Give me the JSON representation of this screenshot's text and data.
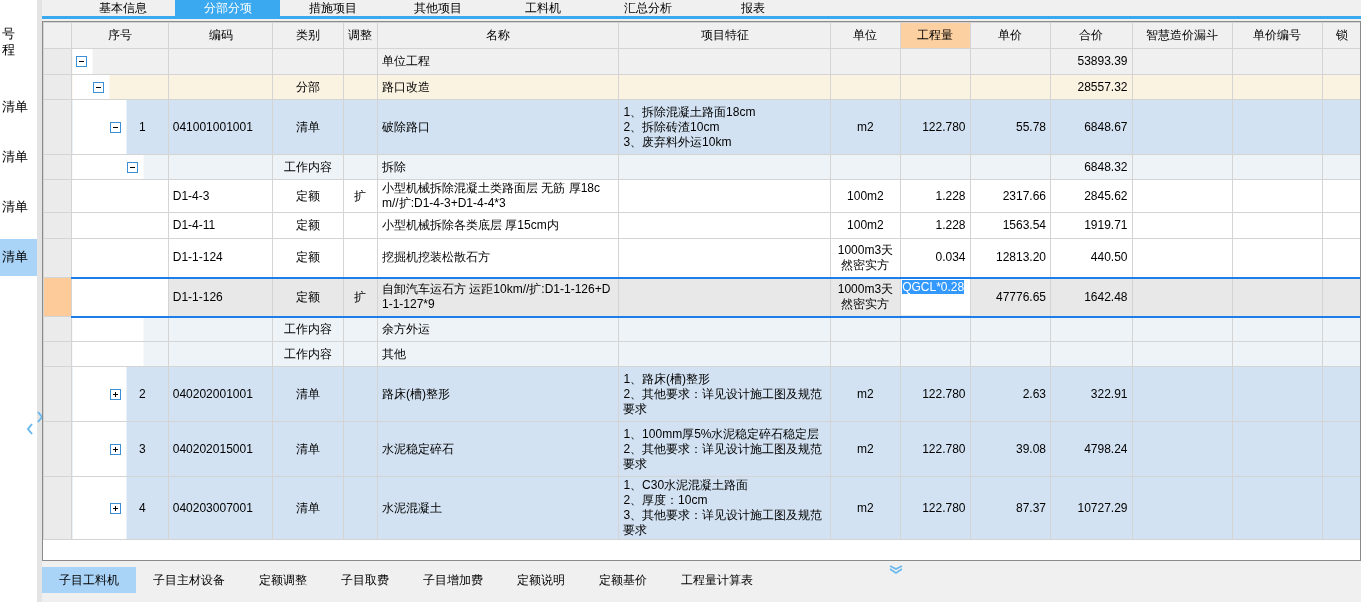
{
  "top_tabs": [
    {
      "label": "基本信息",
      "selected": false
    },
    {
      "label": "分部分项",
      "selected": true
    },
    {
      "label": "措施项目",
      "selected": false
    },
    {
      "label": "其他项目",
      "selected": false
    },
    {
      "label": "工料机",
      "selected": false
    },
    {
      "label": "汇总分析",
      "selected": false
    },
    {
      "label": "报表",
      "selected": false
    }
  ],
  "sidebar": {
    "items": [
      {
        "label": "号",
        "selected": false
      },
      {
        "label": "程",
        "selected": false
      },
      {
        "label": "清单",
        "selected": false
      },
      {
        "label": "清单",
        "selected": false
      },
      {
        "label": "清单",
        "selected": false
      },
      {
        "label": "清单",
        "selected": true
      }
    ]
  },
  "table": {
    "columns": [
      {
        "label": "序号",
        "selected": false
      },
      {
        "label": "编码",
        "selected": false
      },
      {
        "label": "类别",
        "selected": false
      },
      {
        "label": "调整",
        "selected": false
      },
      {
        "label": "名称",
        "selected": false
      },
      {
        "label": "项目特征",
        "selected": false
      },
      {
        "label": "单位",
        "selected": false
      },
      {
        "label": "工程量",
        "selected": true
      },
      {
        "label": "单价",
        "selected": false
      },
      {
        "label": "合价",
        "selected": false
      },
      {
        "label": "智慧造价漏斗",
        "selected": false
      },
      {
        "label": "单价编号",
        "selected": false
      },
      {
        "label": "锁",
        "selected": false
      }
    ],
    "rows": [
      {
        "kind": "unit",
        "name": "单位工程",
        "total": "53893.39",
        "expanded": true,
        "selected": false,
        "children": [
          {
            "kind": "section",
            "category": "分部",
            "name": "路口改造",
            "total": "28557.32",
            "expanded": true,
            "selected": false,
            "children": [
              {
                "kind": "item",
                "index": "1",
                "code": "041001001001",
                "category": "清单",
                "name": "破除路口",
                "features": "1、拆除混凝土路面18cm\n2、拆除砖渣10cm\n3、废弃料外运10km",
                "unit": "m2",
                "quantity": "122.780",
                "unit_price": "55.78",
                "total": "6848.67",
                "expanded": true,
                "selected": false,
                "children": [
                  {
                    "kind": "content",
                    "category": "工作内容",
                    "name": "拆除",
                    "total": "6848.32",
                    "expanded": true,
                    "selected": false,
                    "children": [
                      {
                        "kind": "quota",
                        "code": "D1-4-3",
                        "category": "定额",
                        "adjust": "扩",
                        "name": "小型机械拆除混凝土类路面层 无筋 厚18cm//扩:D1-4-3+D1-4-4*3",
                        "unit": "100m2",
                        "quantity": "1.228",
                        "unit_price": "2317.66",
                        "total": "2845.62",
                        "selected": false
                      },
                      {
                        "kind": "quota",
                        "code": "D1-4-11",
                        "category": "定额",
                        "name": "小型机械拆除各类底层 厚15cm内",
                        "unit": "100m2",
                        "quantity": "1.228",
                        "unit_price": "1563.54",
                        "total": "1919.71",
                        "selected": false
                      },
                      {
                        "kind": "quota",
                        "code": "D1-1-124",
                        "category": "定额",
                        "name": "挖掘机挖装松散石方",
                        "unit": "1000m3天然密实方",
                        "quantity": "0.034",
                        "unit_price": "12813.20",
                        "total": "440.50",
                        "selected": false
                      },
                      {
                        "kind": "quota",
                        "code": "D1-1-126",
                        "category": "定额",
                        "adjust": "扩",
                        "name": "自卸汽车运石方 运距10km//扩:D1-1-126+D1-1-127*9",
                        "unit": "1000m3天然密实方",
                        "quantity": "QGCL*0.28",
                        "unit_price": "47776.65",
                        "total": "1642.48",
                        "selected": true
                      }
                    ]
                  },
                  {
                    "kind": "content",
                    "category": "工作内容",
                    "name": "余方外运",
                    "selected": false
                  },
                  {
                    "kind": "content",
                    "category": "工作内容",
                    "name": "其他",
                    "selected": false
                  }
                ]
              },
              {
                "kind": "item",
                "index": "2",
                "code": "040202001001",
                "category": "清单",
                "name": "路床(槽)整形",
                "features": "1、路床(槽)整形\n2、其他要求：详见设计施工图及规范要求",
                "unit": "m2",
                "quantity": "122.780",
                "unit_price": "2.63",
                "total": "322.91",
                "expanded": false,
                "selected": false
              },
              {
                "kind": "item",
                "index": "3",
                "code": "040202015001",
                "category": "清单",
                "name": "水泥稳定碎石",
                "features": "1、100mm厚5%水泥稳定碎石稳定层\n2、其他要求：详见设计施工图及规范要求",
                "unit": "m2",
                "quantity": "122.780",
                "unit_price": "39.08",
                "total": "4798.24",
                "expanded": false,
                "selected": false
              },
              {
                "kind": "item",
                "index": "4",
                "code": "040203007001",
                "category": "清单",
                "name": "水泥混凝土",
                "features": "1、C30水泥混凝土路面\n2、厚度：10cm\n3、其他要求：详见设计施工图及规范要求",
                "unit": "m2",
                "quantity": "122.780",
                "unit_price": "87.37",
                "total": "10727.29",
                "expanded": false,
                "selected": false
              }
            ]
          }
        ]
      }
    ]
  },
  "bottom_tabs": [
    {
      "label": "子目工料机",
      "selected": true
    },
    {
      "label": "子目主材设备",
      "selected": false
    },
    {
      "label": "定额调整",
      "selected": false
    },
    {
      "label": "子目取费",
      "selected": false
    },
    {
      "label": "子目增加费",
      "selected": false
    },
    {
      "label": "定额说明",
      "selected": false
    },
    {
      "label": "定额基价",
      "selected": false
    },
    {
      "label": "工程量计算表",
      "selected": false
    }
  ]
}
